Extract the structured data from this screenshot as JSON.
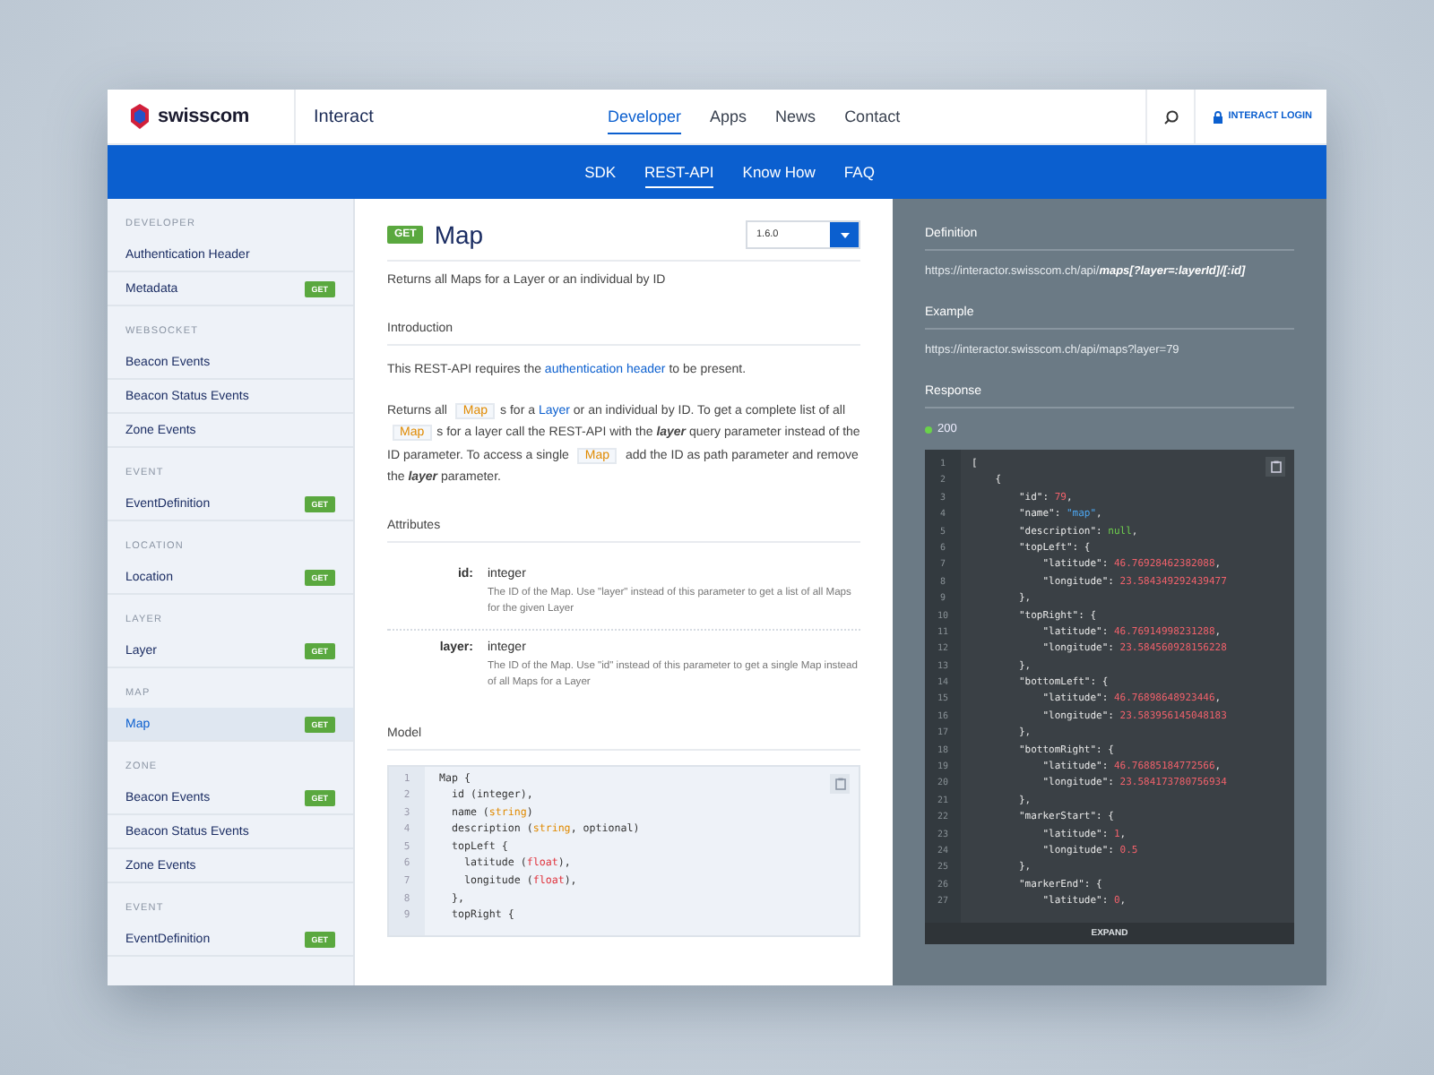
{
  "header": {
    "logo": "swisscom",
    "product": "Interact",
    "nav": [
      {
        "label": "Developer",
        "selected": true
      },
      {
        "label": "Apps",
        "selected": false
      },
      {
        "label": "News",
        "selected": false
      },
      {
        "label": "Contact",
        "selected": false
      }
    ],
    "login": "INTERACT LOGIN",
    "subnav": [
      {
        "label": "SDK",
        "selected": false
      },
      {
        "label": "REST-API",
        "selected": true
      },
      {
        "label": "Know How",
        "selected": false
      },
      {
        "label": "FAQ",
        "selected": false
      }
    ]
  },
  "sidebar": {
    "sections": [
      {
        "title": "DEVELOPER",
        "items": [
          {
            "label": "Authentication Header",
            "selected": false
          },
          {
            "label": "Metadata",
            "badge": "GET",
            "selected": false
          }
        ]
      },
      {
        "title": "WEBSOCKET",
        "items": [
          {
            "label": "Beacon Events",
            "selected": false
          },
          {
            "label": "Beacon Status Events",
            "selected": false
          },
          {
            "label": "Zone Events",
            "selected": false
          }
        ]
      },
      {
        "title": "EVENT",
        "items": [
          {
            "label": "EventDefinition",
            "badge": "GET",
            "selected": false
          }
        ]
      },
      {
        "title": "LOCATION",
        "items": [
          {
            "label": "Location",
            "badge": "GET",
            "selected": false
          }
        ]
      },
      {
        "title": "LAYER",
        "items": [
          {
            "label": "Layer",
            "badge": "GET",
            "selected": false
          }
        ]
      },
      {
        "title": "MAP",
        "items": [
          {
            "label": "Map",
            "badge": "GET",
            "selected": true
          }
        ]
      },
      {
        "title": "ZONE",
        "items": [
          {
            "label": "Beacon Events",
            "badge": "GET",
            "selected": false
          },
          {
            "label": "Beacon Status Events",
            "selected": false
          },
          {
            "label": "Zone Events",
            "selected": false
          }
        ]
      },
      {
        "title": "EVENT",
        "items": [
          {
            "label": "EventDefinition",
            "badge": "GET",
            "selected": false
          }
        ]
      }
    ]
  },
  "main": {
    "method": "GET",
    "title": "Map",
    "version": "1.6.0",
    "summary": "Returns all Maps for a Layer or an individual by ID",
    "introduction": {
      "heading": "Introduction",
      "paragraphs": [
        [
          {
            "kind": "text",
            "text": "This REST-API requires the "
          },
          {
            "kind": "link",
            "text": "authentication header"
          },
          {
            "kind": "text",
            "text": " to be present."
          }
        ],
        [
          {
            "kind": "text",
            "text": "Returns all "
          },
          {
            "kind": "code",
            "text": "Map"
          },
          {
            "kind": "text",
            "text": "s for a "
          },
          {
            "kind": "link",
            "text": "Layer"
          },
          {
            "kind": "text",
            "text": " or an individual by ID. To get a complete list of all "
          },
          {
            "kind": "code",
            "text": "Map"
          },
          {
            "kind": "text",
            "text": "s for a layer call the REST-API with the "
          },
          {
            "kind": "em",
            "text": "layer"
          },
          {
            "kind": "text",
            "text": " query parameter instead of the ID parameter. To access a single "
          },
          {
            "kind": "code",
            "text": "Map"
          },
          {
            "kind": "text",
            "text": " add the ID as path parameter and remove the "
          },
          {
            "kind": "em",
            "text": "layer"
          },
          {
            "kind": "text",
            "text": " parameter."
          }
        ]
      ]
    },
    "attributes": {
      "heading": "Attributes",
      "items": [
        {
          "name": "id:",
          "type": "integer",
          "description": "The ID of the Map. Use \"layer\" instead of this parameter to get a list of all Maps for the given Layer"
        },
        {
          "name": "layer:",
          "type": "integer",
          "description": "The ID of the Map. Use \"id\" instead of this parameter to get a single Map instead of all Maps for a Layer"
        }
      ]
    },
    "model": {
      "heading": "Model",
      "lines": [
        {
          "no": "1",
          "tokens": [
            {
              "text": "Map {",
              "kind": "plain"
            }
          ]
        },
        {
          "no": "2",
          "tokens": [
            {
              "text": "  id (integer),",
              "kind": "plain"
            }
          ]
        },
        {
          "no": "3",
          "tokens": [
            {
              "text": "  name (",
              "kind": "plain"
            },
            {
              "text": "string",
              "kind": "type"
            },
            {
              "text": ")",
              "kind": "plain"
            }
          ]
        },
        {
          "no": "4",
          "tokens": [
            {
              "text": "  description (",
              "kind": "plain"
            },
            {
              "text": "string",
              "kind": "type"
            },
            {
              "text": ", optional)",
              "kind": "plain"
            }
          ]
        },
        {
          "no": "5",
          "tokens": [
            {
              "text": "  topLeft {",
              "kind": "plain"
            }
          ]
        },
        {
          "no": "6",
          "tokens": [
            {
              "text": "    latitude (",
              "kind": "plain"
            },
            {
              "text": "float",
              "kind": "float"
            },
            {
              "text": "),",
              "kind": "plain"
            }
          ]
        },
        {
          "no": "7",
          "tokens": [
            {
              "text": "    longitude (",
              "kind": "plain"
            },
            {
              "text": "float",
              "kind": "float"
            },
            {
              "text": "),",
              "kind": "plain"
            }
          ]
        },
        {
          "no": "8",
          "tokens": [
            {
              "text": "  },",
              "kind": "plain"
            }
          ]
        },
        {
          "no": "9",
          "tokens": [
            {
              "text": "  topRight {",
              "kind": "plain"
            }
          ]
        }
      ]
    }
  },
  "details": {
    "definition": {
      "heading": "Definition",
      "parts": [
        {
          "kind": "text",
          "text": "https://interactor.swisscom.ch/api/"
        },
        {
          "kind": "strong",
          "text": "maps[?layer=:layerId]/[:id]"
        }
      ]
    },
    "example": {
      "heading": "Example",
      "url": "https://interactor.swisscom.ch/api/maps?layer=79"
    },
    "response": {
      "heading": "Response",
      "status": "200",
      "expand": "EXPAND",
      "lines": [
        {
          "no": "1",
          "tokens": [
            {
              "text": "[",
              "kind": "plain"
            }
          ]
        },
        {
          "no": "2",
          "tokens": [
            {
              "text": "    {",
              "kind": "plain"
            }
          ]
        },
        {
          "no": "3",
          "tokens": [
            {
              "text": "        \"id\": ",
              "kind": "plain"
            },
            {
              "text": "79",
              "kind": "number"
            },
            {
              "text": ",",
              "kind": "plain"
            }
          ]
        },
        {
          "no": "4",
          "tokens": [
            {
              "text": "        \"name\": ",
              "kind": "plain"
            },
            {
              "text": "\"map\"",
              "kind": "string"
            },
            {
              "text": ",",
              "kind": "plain"
            }
          ]
        },
        {
          "no": "5",
          "tokens": [
            {
              "text": "        \"description\": ",
              "kind": "plain"
            },
            {
              "text": "null",
              "kind": "null"
            },
            {
              "text": ",",
              "kind": "plain"
            }
          ]
        },
        {
          "no": "6",
          "tokens": [
            {
              "text": "        \"topLeft\": {",
              "kind": "plain"
            }
          ]
        },
        {
          "no": "7",
          "tokens": [
            {
              "text": "            \"latitude\": ",
              "kind": "plain"
            },
            {
              "text": "46.76928462382088",
              "kind": "number"
            },
            {
              "text": ",",
              "kind": "plain"
            }
          ]
        },
        {
          "no": "8",
          "tokens": [
            {
              "text": "            \"longitude\": ",
              "kind": "plain"
            },
            {
              "text": "23.584349292439477",
              "kind": "number"
            }
          ]
        },
        {
          "no": "9",
          "tokens": [
            {
              "text": "        },",
              "kind": "plain"
            }
          ]
        },
        {
          "no": "10",
          "tokens": [
            {
              "text": "        \"topRight\": {",
              "kind": "plain"
            }
          ]
        },
        {
          "no": "11",
          "tokens": [
            {
              "text": "            \"latitude\": ",
              "kind": "plain"
            },
            {
              "text": "46.76914998231288",
              "kind": "number"
            },
            {
              "text": ",",
              "kind": "plain"
            }
          ]
        },
        {
          "no": "12",
          "tokens": [
            {
              "text": "            \"longitude\": ",
              "kind": "plain"
            },
            {
              "text": "23.584560928156228",
              "kind": "number"
            }
          ]
        },
        {
          "no": "13",
          "tokens": [
            {
              "text": "        },",
              "kind": "plain"
            }
          ]
        },
        {
          "no": "14",
          "tokens": [
            {
              "text": "        \"bottomLeft\": {",
              "kind": "plain"
            }
          ]
        },
        {
          "no": "15",
          "tokens": [
            {
              "text": "            \"latitude\": ",
              "kind": "plain"
            },
            {
              "text": "46.76898648923446",
              "kind": "number"
            },
            {
              "text": ",",
              "kind": "plain"
            }
          ]
        },
        {
          "no": "16",
          "tokens": [
            {
              "text": "            \"longitude\": ",
              "kind": "plain"
            },
            {
              "text": "23.583956145048183",
              "kind": "number"
            }
          ]
        },
        {
          "no": "17",
          "tokens": [
            {
              "text": "        },",
              "kind": "plain"
            }
          ]
        },
        {
          "no": "18",
          "tokens": [
            {
              "text": "        \"bottomRight\": {",
              "kind": "plain"
            }
          ]
        },
        {
          "no": "19",
          "tokens": [
            {
              "text": "            \"latitude\": ",
              "kind": "plain"
            },
            {
              "text": "46.76885184772566",
              "kind": "number"
            },
            {
              "text": ",",
              "kind": "plain"
            }
          ]
        },
        {
          "no": "20",
          "tokens": [
            {
              "text": "            \"longitude\": ",
              "kind": "plain"
            },
            {
              "text": "23.584173780756934",
              "kind": "number"
            }
          ]
        },
        {
          "no": "21",
          "tokens": [
            {
              "text": "        },",
              "kind": "plain"
            }
          ]
        },
        {
          "no": "22",
          "tokens": [
            {
              "text": "        \"markerStart\": {",
              "kind": "plain"
            }
          ]
        },
        {
          "no": "23",
          "tokens": [
            {
              "text": "            \"latitude\": ",
              "kind": "plain"
            },
            {
              "text": "1",
              "kind": "number"
            },
            {
              "text": ",",
              "kind": "plain"
            }
          ]
        },
        {
          "no": "24",
          "tokens": [
            {
              "text": "            \"longitude\": ",
              "kind": "plain"
            },
            {
              "text": "0.5",
              "kind": "number"
            }
          ]
        },
        {
          "no": "25",
          "tokens": [
            {
              "text": "        },",
              "kind": "plain"
            }
          ]
        },
        {
          "no": "26",
          "tokens": [
            {
              "text": "        \"markerEnd\": {",
              "kind": "plain"
            }
          ]
        },
        {
          "no": "27",
          "tokens": [
            {
              "text": "            \"latitude\": ",
              "kind": "plain"
            },
            {
              "text": "0",
              "kind": "number"
            },
            {
              "text": ",",
              "kind": "plain"
            }
          ]
        }
      ]
    }
  }
}
